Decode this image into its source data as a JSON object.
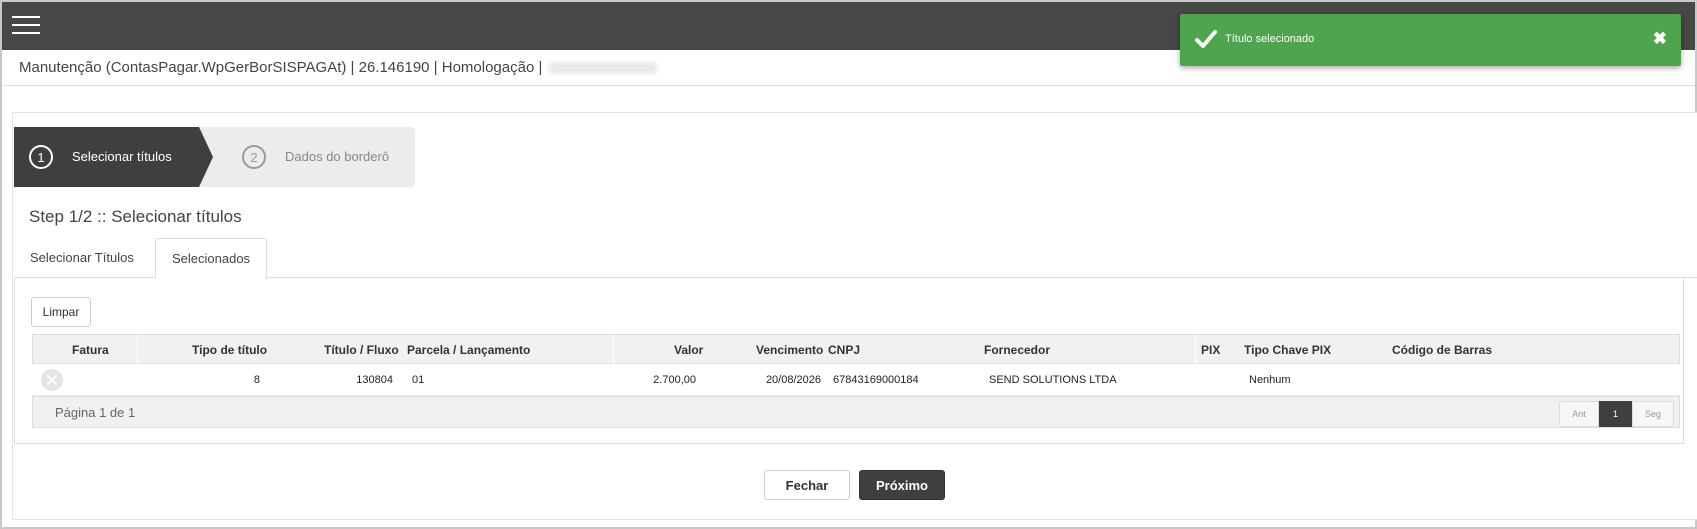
{
  "header": {
    "title": "Manutenção (ContasPagar.WpGerBorSISPAGAt) | 26.146190 | Homologação |"
  },
  "toast": {
    "message": "Título selecionado",
    "close_symbol": "✖",
    "color": "#4fa44e"
  },
  "wizard": {
    "steps": [
      {
        "number": "1",
        "label": "Selecionar títulos",
        "active": true
      },
      {
        "number": "2",
        "label": "Dados do borderô",
        "active": false
      }
    ]
  },
  "step_heading": "Step 1/2 :: Selecionar títulos",
  "tabs": [
    {
      "label": "Selecionar Títulos",
      "active": false
    },
    {
      "label": "Selecionados",
      "active": true
    }
  ],
  "limpar_label": "Limpar",
  "grid": {
    "columns": [
      "Fatura",
      "Tipo de título",
      "Título / Fluxo",
      "Parcela / Lançamento",
      "Valor",
      "Vencimento",
      "CNPJ",
      "Fornecedor",
      "PIX",
      "Tipo Chave PIX",
      "Código de Barras"
    ],
    "rows": [
      {
        "fatura": "",
        "tipo_titulo": "8",
        "titulo_fluxo": "130804",
        "parcela": "01",
        "valor": "2.700,00",
        "vencimento": "20/08/2026",
        "cnpj": "67843169000184",
        "fornecedor": "SEND SOLUTIONS LTDA",
        "pix": "",
        "tipo_chave_pix": "Nenhum",
        "codigo_barras": ""
      }
    ],
    "page_info": "Página 1 de 1",
    "pager": {
      "prev": "Ant",
      "current": "1",
      "next": "Seg"
    }
  },
  "footer": {
    "fechar_label": "Fechar",
    "proximo_label": "Próximo"
  },
  "icons": {
    "menu": "hamburger-icon",
    "toast": "check-icon",
    "remove": "remove-circle-icon"
  },
  "colors": {
    "topbar": "#474747",
    "accent_dark": "#3f3f3f",
    "success": "#4fa44e"
  }
}
